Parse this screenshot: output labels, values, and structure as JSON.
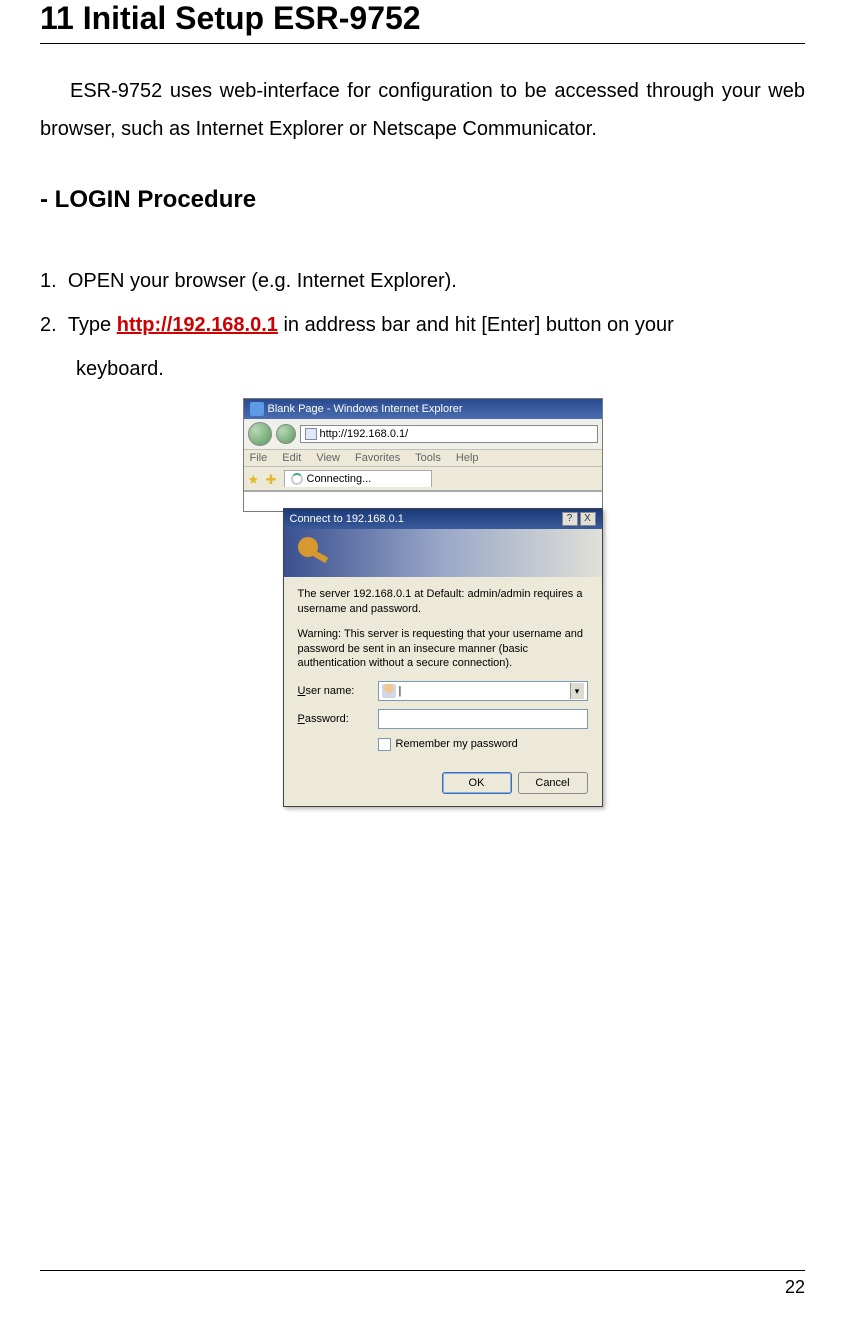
{
  "doc": {
    "title": "11 Initial Setup ESR-9752",
    "intro": "ESR-9752 uses web-interface for configuration to be accessed through your web browser, such as Internet Explorer or Netscape Communicator.",
    "procedure_heading": "- LOGIN Procedure",
    "step1_num": "1.",
    "step1_text": "OPEN your browser (e.g. Internet Explorer).",
    "step2_num": "2.",
    "step2_a": "Type ",
    "step2_url": "http://192.168.0.1",
    "step2_b": " in address bar and hit [Enter] button on your",
    "step2_c": "keyboard.",
    "page_number": "22"
  },
  "ie": {
    "title": "Blank Page - Windows Internet Explorer",
    "address": "http://192.168.0.1/",
    "menu": {
      "file": "File",
      "edit": "Edit",
      "view": "View",
      "favorites": "Favorites",
      "tools": "Tools",
      "help": "Help"
    },
    "tab": "Connecting..."
  },
  "dialog": {
    "title": "Connect to 192.168.0.1",
    "msg1": "The server 192.168.0.1 at Default: admin/admin requires a username and password.",
    "msg2": "Warning: This server is requesting that your username and password be sent in an insecure manner (basic authentication without a secure connection).",
    "user_u": "U",
    "user_rest": "ser name:",
    "pass_u": "P",
    "pass_rest": "assword:",
    "remember_u": "R",
    "remember_rest": "emember my password",
    "ok": "OK",
    "cancel": "Cancel",
    "close": "X",
    "help": "?"
  }
}
